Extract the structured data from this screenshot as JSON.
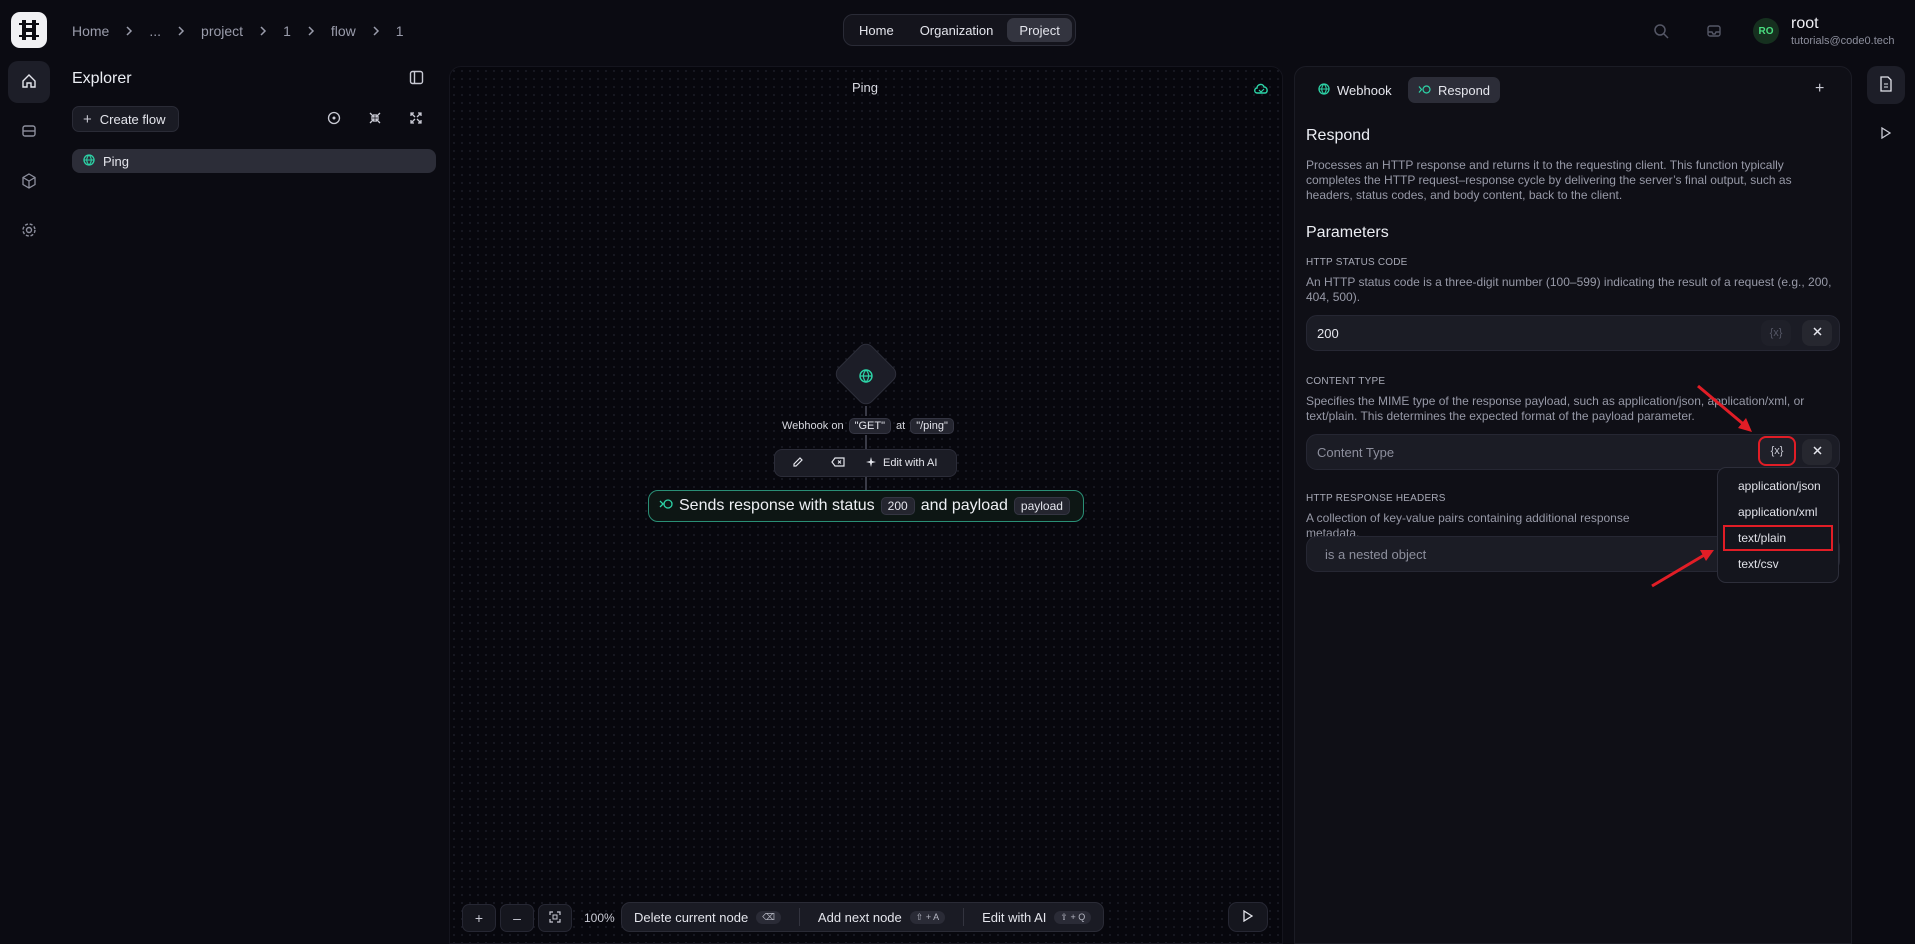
{
  "breadcrumb": [
    "Home",
    "...",
    "project",
    "1",
    "flow",
    "1"
  ],
  "top_nav": {
    "home": "Home",
    "organization": "Organization",
    "project": "Project"
  },
  "user": {
    "initials": "RO",
    "name": "root",
    "email": "tutorials@code0.tech"
  },
  "explorer": {
    "title": "Explorer",
    "create_flow": "Create flow",
    "items": [
      {
        "label": "Ping"
      }
    ]
  },
  "canvas": {
    "title": "Ping",
    "trigger": {
      "text_a": "Webhook on",
      "method": "\"GET\"",
      "text_b": "at",
      "path": "\"/ping\""
    },
    "toolbar": {
      "edit_ai": "Edit with AI"
    },
    "response_node": {
      "text_a": "Sends response with status",
      "status": "200",
      "text_b": "and payload",
      "payload": "payload"
    },
    "zoom": "100%",
    "actions": {
      "delete": "Delete current node",
      "delete_kbd": "⌫",
      "add_next": "Add next node",
      "add_kbd": "⇧ + A",
      "edit_ai": "Edit with AI",
      "edit_kbd": "⇧ + Q"
    }
  },
  "panel": {
    "tabs": [
      {
        "label": "Webhook"
      },
      {
        "label": "Respond"
      }
    ],
    "title": "Respond",
    "description": "Processes an HTTP response and returns it to the requesting client. This function typically completes the HTTP request–response cycle by delivering the server’s final output, such as headers, status codes, and body content, back to the client.",
    "parameters_title": "Parameters",
    "status_code": {
      "label": "HTTP STATUS CODE",
      "description": "An HTTP status code is a three-digit number (100–599) indicating the result of a request (e.g., 200, 404, 500).",
      "value": "200"
    },
    "content_type": {
      "label": "CONTENT TYPE",
      "description": "Specifies the MIME type of the response payload, such as application/json, application/xml, or text/plain. This determines the expected format of the payload parameter.",
      "placeholder": "Content Type",
      "options": [
        "application/json",
        "application/xml",
        "text/plain",
        "text/csv"
      ]
    },
    "headers": {
      "label": "HTTP RESPONSE HEADERS",
      "description": "A collection of key-value pairs containing additional response metadata.",
      "value": "is a nested object"
    },
    "variable_button": "{x}"
  },
  "colors": {
    "accent": "#2dd4a7",
    "highlight": "#e11d26",
    "background": "#0b0b12"
  }
}
